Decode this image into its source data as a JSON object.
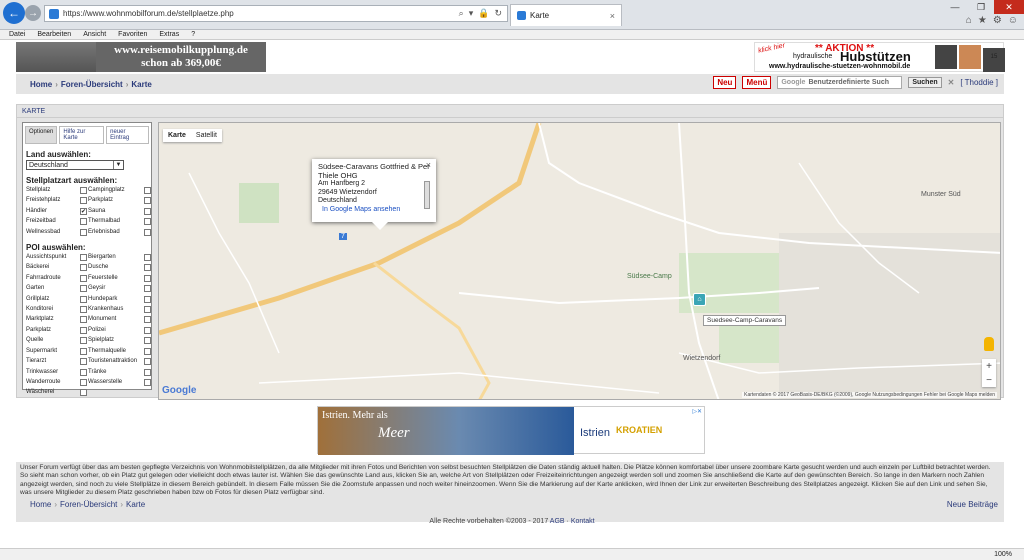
{
  "browser": {
    "url": "https://www.wohnmobilforum.de/stellplaetze.php",
    "tab_title": "Karte",
    "menu": [
      "Datei",
      "Bearbeiten",
      "Ansicht",
      "Favoriten",
      "Extras",
      "?"
    ],
    "zoom": "100%"
  },
  "header": {
    "logo_line1": "www.reisemobilkupplung.de",
    "logo_line2": "schon ab 369,00€",
    "ad_klick": "klick hier",
    "ad_aktion": "** AKTION **",
    "ad_hyd": "hydraulische",
    "ad_hub": "Hubstützen",
    "ad_url": "www.hydraulische-stuetzen-wohnmobil.de",
    "ad_badge": "15"
  },
  "nav": {
    "home": "Home",
    "forum": "Foren-Übersicht",
    "karte": "Karte",
    "neu": "Neu",
    "menue": "Menü",
    "search_google": "Google",
    "search_placeholder": "Benutzerdefinierte Such",
    "search_btn": "Suchen",
    "close": "✕",
    "user": "[ Thoddie ]"
  },
  "section_title": "KARTE",
  "sidebar": {
    "tabs": [
      "Optionen",
      "Hilfe zur Karte",
      "neuer Eintrag"
    ],
    "land_head": "Land auswählen:",
    "land_value": "Deutschland",
    "stell_head": "Stellplatzart auswählen:",
    "stell": [
      {
        "a": "Stellplatz",
        "ac": false,
        "b": "Campingplatz",
        "bc": false
      },
      {
        "a": "Freistehplatz",
        "ac": false,
        "b": "Parkplatz",
        "bc": false
      },
      {
        "a": "Händler",
        "ac": true,
        "b": "Sauna",
        "bc": false
      },
      {
        "a": "Freizeitbad",
        "ac": false,
        "b": "Thermalbad",
        "bc": false
      },
      {
        "a": "Wellnessbad",
        "ac": false,
        "b": "Erlebnisbad",
        "bc": false
      }
    ],
    "poi_head": "POI auswählen:",
    "poi": [
      {
        "a": "Aussichtspunkt",
        "b": "Biergarten"
      },
      {
        "a": "Bäckerei",
        "b": "Dusche"
      },
      {
        "a": "Fahrradroute",
        "b": "Feuerstelle"
      },
      {
        "a": "Garten",
        "b": "Geysir"
      },
      {
        "a": "Grillplatz",
        "b": "Hundepark"
      },
      {
        "a": "Konditorei",
        "b": "Krankenhaus"
      },
      {
        "a": "Marktplatz",
        "b": "Monument"
      },
      {
        "a": "Parkplatz",
        "b": "Polizei"
      },
      {
        "a": "Quelle",
        "b": "Spielplatz"
      },
      {
        "a": "Supermarkt",
        "b": "Thermalquelle"
      },
      {
        "a": "Tierarzt",
        "b": "Touristenattraktion"
      },
      {
        "a": "Trinkwasser",
        "b": "Tränke"
      },
      {
        "a": "Wanderroute",
        "b": "Wasserstelle"
      },
      {
        "a": "Wäscherei",
        "b": ""
      }
    ]
  },
  "map": {
    "type_karte": "Karte",
    "type_sat": "Satellit",
    "popup_title": "Südsee-Caravans Gottfried & Per Thiele OHG",
    "popup_street": "Am Hanfberg 2",
    "popup_city": "29649 Wietzendorf",
    "popup_country": "Deutschland",
    "popup_link": "In Google Maps ansehen",
    "label_suedsee": "Südsee-Camp",
    "label_munster": "Munster Süd",
    "label_wietzendorf": "Wietzendorf",
    "label_road_a7": "7",
    "marker_tip": "Suedsee-Camp-Caravans",
    "google": "Google",
    "attribution": "Kartendaten © 2017 GeoBasis-DE/BKG (©2009), Google   Nutzungsbedingungen   Fehler bei Google Maps melden"
  },
  "banner": {
    "line1": "Istrien. Mehr als",
    "line2": "Meer",
    "istrien": "Istrien",
    "kroatien": "KROATIEN"
  },
  "description": "Unser Forum verfügt über das am besten gepflegte Verzeichnis von Wohnmobilstellplätzen, da alle Mitglieder mit ihren Fotos und Berichten von selbst besuchten Stellplätzen die Daten ständig aktuell halten. Die Plätze können komfortabel über unsere zoombare Karte gesucht werden und auch einzeln per Luftbild betrachtet werden. So sieht man schon vorher, ob ein Platz gut gelegen oder vielleicht doch etwas lauter ist. Wählen Sie das gewünschte Land aus, klicken Sie an, welche Art von Stellplätzen oder Freizeiteinrichtungen angezeigt werden soll und zoomen Sie anschließend die Karte auf den gewünschten Bereich. So lange in den Markern noch Zahlen angezeigt werden, sind noch zu viele Stellplätze in diesem Bereich gebündelt. In diesem Falle müssen Sie die Zoomstufe anpassen und noch weiter hineinzoomen. Wenn Sie die Markierung auf der Karte anklicken, wird Ihnen der Link zur erweiterten Beschreibung des Stellplatzes angezeigt. Klicken Sie auf den Link und sehen Sie, was unsere Mitglieder zu diesem Platz geschrieben haben bzw ob Fotos für diesen Platz verfügbar sind.",
  "footer": {
    "home": "Home",
    "forum": "Foren-Übersicht",
    "karte": "Karte",
    "neue": "Neue Beiträge",
    "copy": "Alle Rechte vorbehalten ©2003 - 2017",
    "agb": "AGB",
    "kontakt": "Kontakt"
  }
}
